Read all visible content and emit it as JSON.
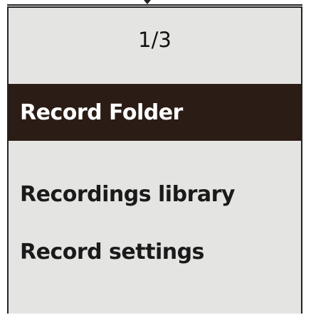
{
  "screen": {
    "page_indicator": "1/3",
    "background_color": "#e4e5e2",
    "selected_color": "#2b1c16"
  },
  "menu": {
    "items": [
      {
        "label": "Record Folder",
        "selected": true
      },
      {
        "label": "Recordings library",
        "selected": false
      },
      {
        "label": "Record settings",
        "selected": false
      }
    ]
  }
}
